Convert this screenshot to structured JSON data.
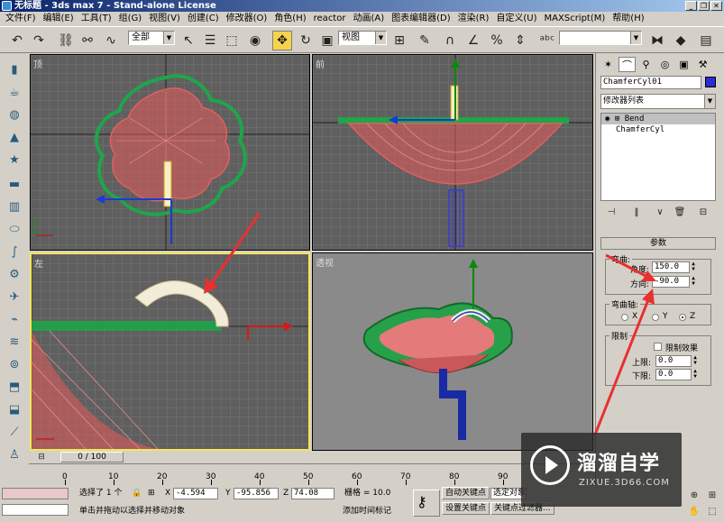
{
  "title": "无标题 - 3ds max 7 - Stand-alone License",
  "menu": [
    "文件(F)",
    "编辑(E)",
    "工具(T)",
    "组(G)",
    "视图(V)",
    "创建(C)",
    "修改器(O)",
    "角色(H)",
    "reactor",
    "动画(A)",
    "图表编辑器(D)",
    "渲染(R)",
    "自定义(U)",
    "MAXScript(M)",
    "帮助(H)"
  ],
  "toolbar": {
    "selection_filter": "全部",
    "ref_coord": "视图",
    "named_sel": ""
  },
  "viewports": {
    "top": "顶",
    "front": "前",
    "left": "左",
    "persp": "透视"
  },
  "command_panel": {
    "object_name": "ChamferCyl01",
    "color": "#2b2bd4",
    "modifier_list": "修改器列表",
    "stack": [
      "Bend",
      "ChamferCyl"
    ],
    "rollout": "参数",
    "bend_group": "弯曲:",
    "angle_label": "角度:",
    "angle_value": "150.0",
    "direction_label": "方向:",
    "direction_value": "-90.0",
    "axis_group": "弯曲轴:",
    "axis_x": "X",
    "axis_y": "Y",
    "axis_z": "Z",
    "axis_selected": "Z",
    "limit_group": "限制",
    "limit_effect": "限制效果",
    "upper_label": "上限:",
    "upper_value": "0.0",
    "lower_label": "下限:",
    "lower_value": "0.0"
  },
  "timeline": {
    "slider": "0 / 100",
    "ticks": [
      "0",
      "10",
      "20",
      "30",
      "40",
      "50",
      "60",
      "70",
      "80",
      "90"
    ]
  },
  "status": {
    "selected": "选择了 1 个",
    "x_label": "X",
    "x_value": "-4.594",
    "y_label": "Y",
    "y_value": "-95.856",
    "z_label": "Z",
    "z_value": "74.08",
    "grid": "栅格 = 10.0",
    "auto_key": "自动关键点",
    "set_key": "设置关键点",
    "selected_obj": "选定对象",
    "key_filter": "关键点过滤器...",
    "prompt": "单击并拖动以选择并移动对象",
    "add_time_tag": "添加时间标记"
  },
  "watermark": {
    "text": "溜溜自学",
    "url": "ZIXUE.3D66.COM"
  }
}
